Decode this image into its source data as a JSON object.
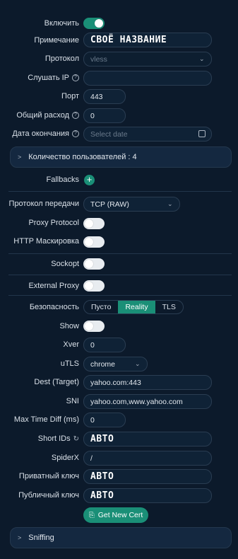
{
  "form": {
    "enable_label": "Включить",
    "remark_label": "Примечание",
    "remark_value": "СВОЁ НАЗВАНИЕ",
    "protocol_label": "Протокол",
    "protocol_value": "vless",
    "listen_label": "Слушать IP",
    "port_label": "Порт",
    "port_value": "443",
    "traffic_label": "Общий расход",
    "traffic_value": "0",
    "expiry_label": "Дата окончания",
    "expiry_placeholder": "Select date",
    "users_section": "Количество пользователей : 4",
    "fallbacks_label": "Fallbacks",
    "transport_label": "Протокол передачи",
    "transport_value": "TCP (RAW)",
    "proxy_protocol_label": "Proxy Protocol",
    "http_mask_label": "HTTP Маскировка",
    "sockopt_label": "Sockopt",
    "external_proxy_label": "External Proxy",
    "security_label": "Безопасность",
    "security_options": [
      "Пусто",
      "Reality",
      "TLS"
    ],
    "show_label": "Show",
    "xver_label": "Xver",
    "xver_value": "0",
    "utls_label": "uTLS",
    "utls_value": "chrome",
    "dest_label": "Dest (Target)",
    "dest_value": "yahoo.com:443",
    "sni_label": "SNI",
    "sni_value": "yahoo.com,www.yahoo.com",
    "maxtime_label": "Max Time Diff (ms)",
    "maxtime_value": "0",
    "shortids_label": "Short IDs",
    "shortids_value": "АВТО",
    "spiderx_label": "SpiderX",
    "spiderx_value": "/",
    "privkey_label": "Приватный ключ",
    "privkey_value": "АВТО",
    "pubkey_label": "Публичный ключ",
    "pubkey_value": "АВТО",
    "get_cert_label": "Get New Cert",
    "sniffing_section": "Sniffing"
  },
  "colors": {
    "accent": "#1a8f77",
    "background": "#0c1a2b",
    "field": "#0f2236"
  }
}
